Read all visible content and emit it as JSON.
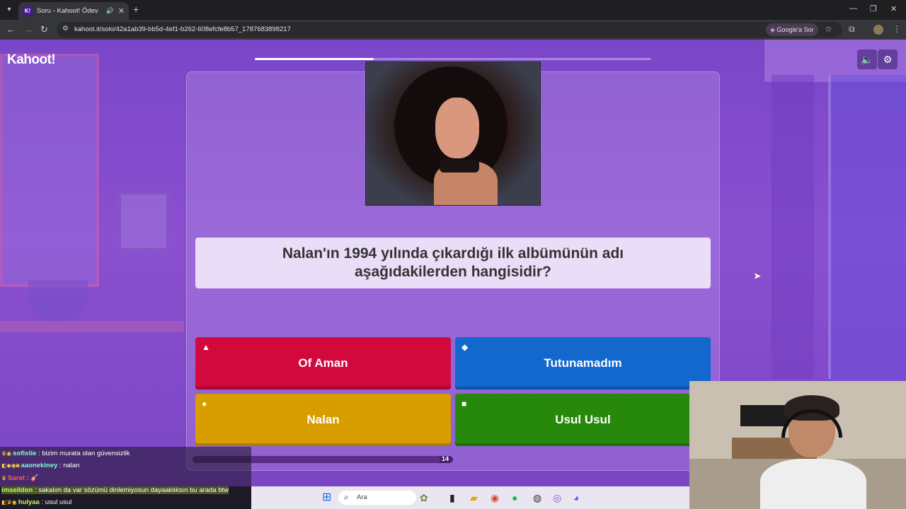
{
  "browser": {
    "tab_title": "Soru - Kahoot! Ödev",
    "favicon_text": "K!",
    "url": "kahoot.it/solo/42a1ab39-bb5d-4ef1-b262-608efcfe8b57_1787683898217",
    "google_sor": "Google'a Sor"
  },
  "game": {
    "logo": "Kahoot!",
    "progress_fraction": 0.3,
    "question": "Nalan'ın 1994 yılında çıkardığı ilk albümünün adı aşağıdakilerden hangisidir?",
    "answers": [
      {
        "label": "Of Aman",
        "shape": "▲",
        "color": "#d2093c"
      },
      {
        "label": "Tutunamadım",
        "shape": "◆",
        "color": "#1368ce"
      },
      {
        "label": "Nalan",
        "shape": "●",
        "color": "#d89e00"
      },
      {
        "label": "Usul Usul",
        "shape": "■",
        "color": "#26890c"
      }
    ],
    "timer": "14",
    "timer_fraction": 0.95
  },
  "chat": [
    {
      "user": "sofistie",
      "user_color": "#7fffd4",
      "text": "bizim murata olan güvensizlik"
    },
    {
      "user": "aaonekiney",
      "user_color": "#7fffd4",
      "text": "nalan"
    },
    {
      "user": "Saret",
      "user_color": "#ff5a5a",
      "text": "🎸"
    },
    {
      "user": "imseildon",
      "user_color": "#b8ff5a",
      "text": "sakalım da var sözümü dinlemiyosun dayaaklıksın bu arada btw"
    },
    {
      "user": "hulyaa",
      "user_color": "#b8ff5a",
      "text": "usul usul"
    }
  ],
  "taskbar": {
    "search_label": "Ara"
  },
  "icons": {
    "menu": "▾",
    "back": "←",
    "forward": "→",
    "reload": "↻",
    "site_info": "⚙",
    "star": "☆",
    "extensions": "⧉",
    "more": "⋮",
    "minimize": "—",
    "restore": "❐",
    "close": "✕",
    "new_tab": "+",
    "tab_close": "✕",
    "tab_audio": "🔊",
    "volume": "🔈",
    "settings": "⚙",
    "cursor": "➤",
    "windows": "⊞",
    "search": "⌕"
  }
}
